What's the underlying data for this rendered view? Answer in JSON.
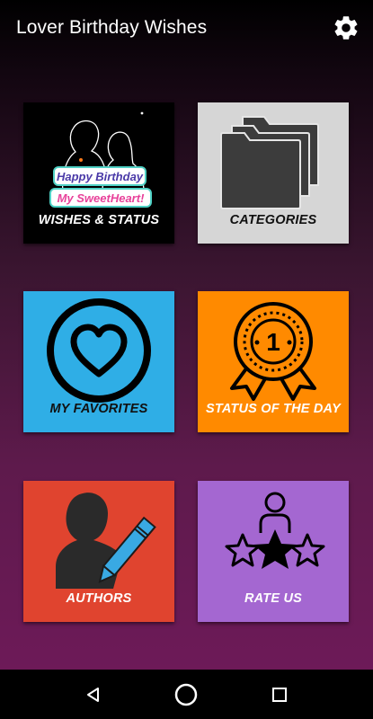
{
  "app_bar": {
    "title": "Lover Birthday Wishes",
    "settings_icon": "gear-icon"
  },
  "tiles": [
    {
      "label": "WISHES & STATUS",
      "bg": "#000000",
      "art_text": [
        "Happy Birthday",
        "My SweetHeart!"
      ],
      "icon": "couple-silhouette-icon"
    },
    {
      "label": "CATEGORIES",
      "bg": "#d6d6d6",
      "icon": "folders-icon"
    },
    {
      "label": "MY FAVORITES",
      "bg": "#2faee6",
      "icon": "heart-circle-icon"
    },
    {
      "label": "STATUS OF THE DAY",
      "bg": "#ff8a00",
      "badge_number": "1",
      "icon": "award-ribbon-icon"
    },
    {
      "label": "AUTHORS",
      "bg": "#e0442f",
      "icon": "author-pen-icon"
    },
    {
      "label": "RATE US",
      "bg": "#a467d1",
      "icon": "rating-stars-icon"
    }
  ],
  "nav_bar": {
    "back_icon": "back-triangle-icon",
    "home_icon": "home-circle-icon",
    "recents_icon": "recents-square-icon"
  },
  "colors": {
    "label_text": "#ffffff",
    "label_text_dark": "#111111",
    "heart_pink": "#e8419a",
    "banner_teal": "#4fd1c5"
  }
}
